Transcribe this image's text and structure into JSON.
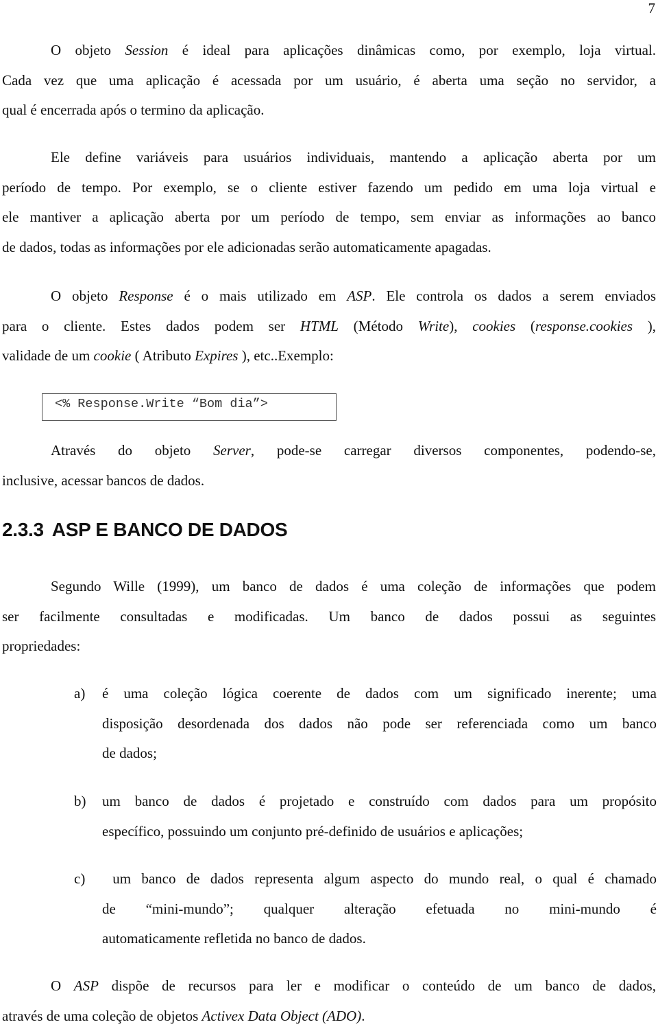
{
  "page": {
    "number": "7"
  },
  "para1": {
    "lines": [
      [
        "O objeto ",
        {
          "i": "Session"
        },
        " é ideal para aplicações dinâmicas como, por exemplo, loja virtual."
      ],
      [
        "Cada vez que uma aplicação é acessada por um usuário, é aberta uma seção no servidor, a"
      ],
      [
        "qual é encerrada após o termino da aplicação."
      ]
    ]
  },
  "para2": {
    "lines": [
      [
        "Ele define variáveis para usuários individuais, mantendo a aplicação aberta por um"
      ],
      [
        "período de tempo. Por exemplo, se o cliente estiver fazendo um pedido em uma loja virtual e"
      ],
      [
        "ele mantiver a aplicação aberta por um período de tempo, sem enviar as informações ao banco"
      ],
      [
        "de dados, todas as informações por ele adicionadas serão automaticamente apagadas."
      ]
    ]
  },
  "para3": {
    "lines": [
      [
        "O objeto ",
        {
          "i": "Response"
        },
        " é o mais utilizado em ",
        {
          "i": "ASP"
        },
        ". Ele controla os dados a serem enviados"
      ],
      [
        "para o cliente. Estes dados podem ser ",
        {
          "i": "HTML"
        },
        " (Método ",
        {
          "i": "Write"
        },
        "), ",
        {
          "i": "cookies"
        },
        " (",
        {
          "i": "response.cookies"
        },
        " ),"
      ],
      [
        "validade de um ",
        {
          "i": "cookie"
        },
        " ( Atributo ",
        {
          "i": "Expires"
        },
        " ), etc..Exemplo:"
      ]
    ]
  },
  "code_example": "<% Response.Write “Bom dia”>",
  "para4": {
    "lines": [
      [
        "Através do objeto ",
        {
          "i": "Server"
        },
        ", pode-se carregar diversos componentes, podendo-se,"
      ],
      [
        "inclusive, acessar bancos de dados."
      ]
    ]
  },
  "section": {
    "number": "2.3.3",
    "title": "ASP E BANCO DE DADOS"
  },
  "para5": {
    "lines": [
      [
        "Segundo Wille (1999), um banco de dados é uma coleção de informações que podem"
      ],
      [
        "ser facilmente consultadas e modificadas. Um banco de dados possui as seguintes"
      ],
      [
        "propriedades:"
      ]
    ]
  },
  "list": [
    {
      "marker": "a)",
      "lines": [
        "é uma coleção lógica coerente de dados com um significado inerente; uma",
        "disposição desordenada dos dados não pode ser referenciada como um banco",
        "de dados;"
      ]
    },
    {
      "marker": "b)",
      "lines": [
        "um banco de dados é projetado e construído com dados para um propósito",
        "específico, possuindo um conjunto pré-definido de usuários e aplicações;"
      ]
    },
    {
      "marker": "c)",
      "lines": [
        " um banco de dados representa algum aspecto do mundo real, o qual é chamado",
        "de “mini-mundo”; qualquer alteração efetuada no mini-mundo é",
        "automaticamente refletida no banco de dados."
      ]
    }
  ],
  "para6": {
    "lines": [
      [
        "O ",
        {
          "i": "ASP"
        },
        " dispõe de recursos para ler e modificar o conteúdo de um banco de dados,"
      ],
      [
        "através de uma coleção de objetos ",
        {
          "i": "Activex Data Object (ADO)"
        },
        "."
      ]
    ]
  }
}
